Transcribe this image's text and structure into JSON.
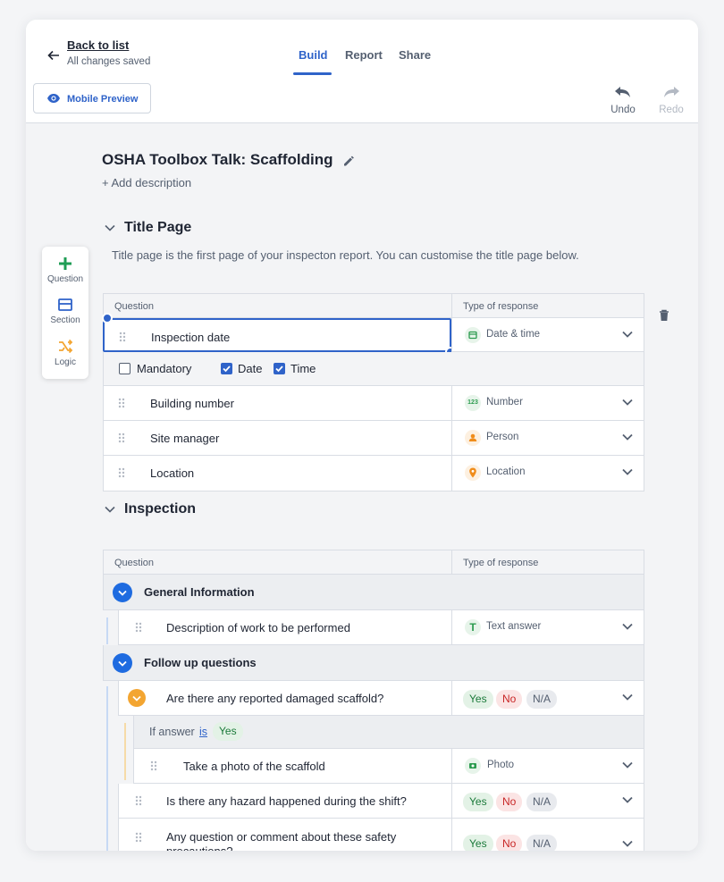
{
  "header": {
    "back_label": "Back to list",
    "saved_status": "All changes saved",
    "tabs": [
      {
        "label": "Build",
        "active": true
      },
      {
        "label": "Report",
        "active": false
      },
      {
        "label": "Share",
        "active": false
      }
    ],
    "mobile_preview_label": "Mobile Preview",
    "undo_label": "Undo",
    "redo_label": "Redo",
    "accent_color": "#2f63c9"
  },
  "toolbar": {
    "question_label": "Question",
    "section_label": "Section",
    "logic_label": "Logic"
  },
  "document": {
    "title": "OSHA Toolbox Talk: Scaffolding",
    "add_description": "+ Add description"
  },
  "title_page": {
    "heading": "Title Page",
    "note": "Title page is the first page of your inspecton report. You can customise the title page below.",
    "col_question": "Question",
    "col_response": "Type of response",
    "rows": [
      {
        "question": "Inspection date",
        "response": "Date & time",
        "icon": "calendar-icon"
      },
      {
        "question": "Building number",
        "response": "Number",
        "icon": "number-icon"
      },
      {
        "question": "Site manager",
        "response": "Person",
        "icon": "person-icon"
      },
      {
        "question": "Location",
        "response": "Location",
        "icon": "location-pin-icon"
      }
    ],
    "options": {
      "mandatory": "Mandatory",
      "date": "Date",
      "time": "Time"
    }
  },
  "inspection": {
    "heading": "Inspection",
    "col_question": "Question",
    "col_response": "Type of response",
    "group1": {
      "label": "General Information",
      "question": "Description of work to be performed",
      "response": "Text answer"
    },
    "group2": {
      "label": "Follow up questions",
      "q1": "Are there any reported damaged scaffold?",
      "if_prefix": "If answer",
      "if_is": "is",
      "if_value": "Yes",
      "sub_question": "Take a photo of the scaffold",
      "sub_response": "Photo",
      "q2": "Is there any hazard happened during the shift?",
      "q3": "Any question or comment about these safety precautions?"
    },
    "answers": {
      "yes": "Yes",
      "no": "No",
      "na": "N/A"
    }
  }
}
